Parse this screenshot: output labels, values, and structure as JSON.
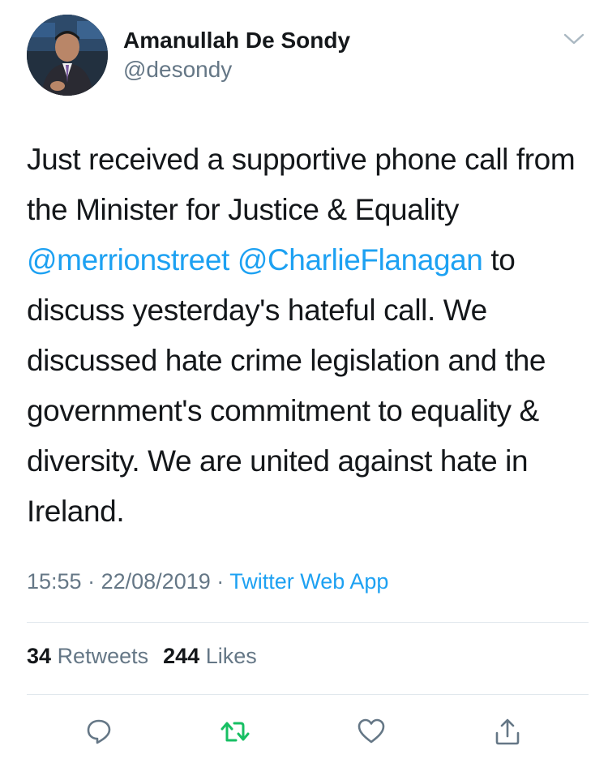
{
  "author": {
    "display_name": "Amanullah De Sondy",
    "handle": "@desondy"
  },
  "tweet": {
    "text_before": "Just received a supportive phone call from the Minister for Justice & Equality ",
    "mentions": [
      "@merrionstreet",
      "@CharlieFlanagan"
    ],
    "text_after": " to discuss yesterday's hateful call. We discussed hate crime legislation and the government's commitment to equality & diversity. We are united against hate in Ireland."
  },
  "meta": {
    "time": "15:55",
    "separator": "·",
    "date": "22/08/2019",
    "source": "Twitter Web App"
  },
  "stats": {
    "retweets_count": "34",
    "retweets_label": "Retweets",
    "likes_count": "244",
    "likes_label": "Likes"
  },
  "actions": {
    "reply_icon": "reply-icon",
    "retweet_icon": "retweet-icon",
    "like_icon": "heart-icon",
    "share_icon": "share-icon"
  },
  "colors": {
    "accent": "#1da1f2",
    "retweet": "#17bf63",
    "muted": "#657786",
    "text": "#14171a",
    "divider": "#e1e8ed"
  }
}
